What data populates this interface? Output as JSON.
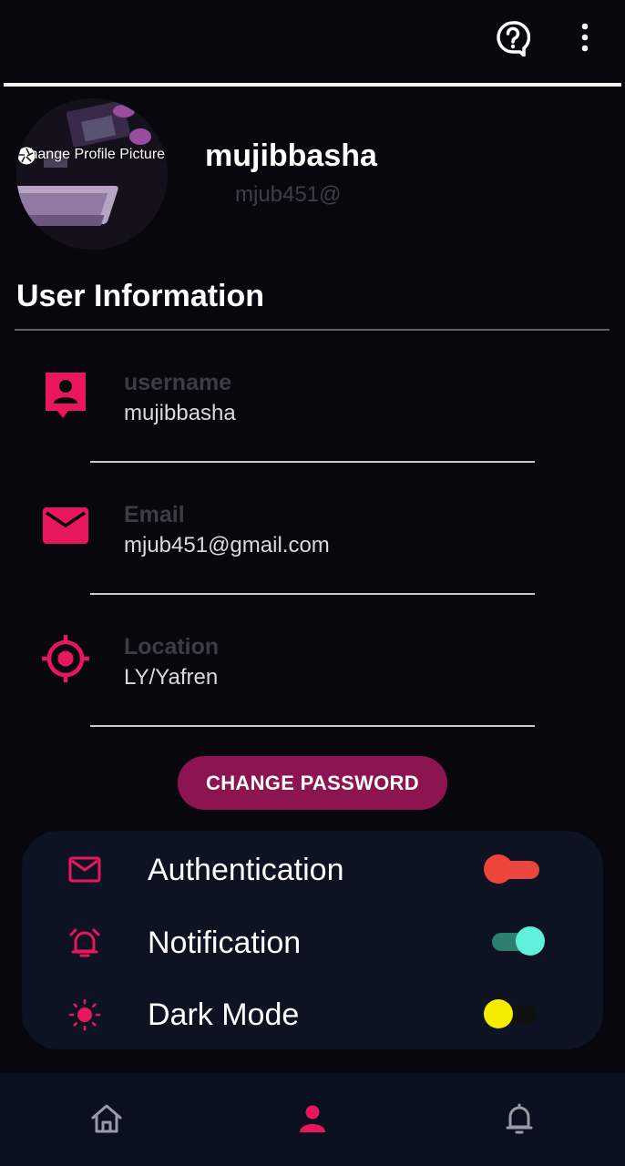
{
  "topbar": {
    "help_icon": "help-circle-icon",
    "more_icon": "more-vertical-icon"
  },
  "profile": {
    "avatar_overlay_label": "Change Profile Picture",
    "camera_icon": "camera-aperture-icon",
    "name": "mujibbasha",
    "handle": "mjub451@"
  },
  "user_information": {
    "title": "User Information",
    "fields": [
      {
        "icon": "account-box-icon",
        "label": "username",
        "value": "mujibbasha"
      },
      {
        "icon": "email-icon",
        "label": "Email",
        "value": "mjub451@gmail.com"
      },
      {
        "icon": "location-target-icon",
        "label": "Location",
        "value": "LY/Yafren"
      }
    ],
    "change_password_label": "CHANGE PASSWORD"
  },
  "settings": [
    {
      "icon": "mail-outline-icon",
      "label": "Authentication",
      "enabled": true,
      "track_color": "#e8463e",
      "thumb_color": "#f0453a"
    },
    {
      "icon": "alarm-bell-icon",
      "label": "Notification",
      "enabled": true,
      "track_color": "#2f7f70",
      "thumb_color": "#5ff1d9"
    },
    {
      "icon": "sun-icon",
      "label": "Dark Mode",
      "enabled": false,
      "track_color": "#111111",
      "thumb_color": "#f5ec00"
    }
  ],
  "bottom_nav": [
    {
      "icon": "home-icon",
      "active": false
    },
    {
      "icon": "person-icon",
      "active": true
    },
    {
      "icon": "bell-icon",
      "active": false
    }
  ],
  "colors": {
    "accent": "#e8175d",
    "background": "#07070d",
    "card": "#0d1322",
    "button": "#8c1450"
  }
}
